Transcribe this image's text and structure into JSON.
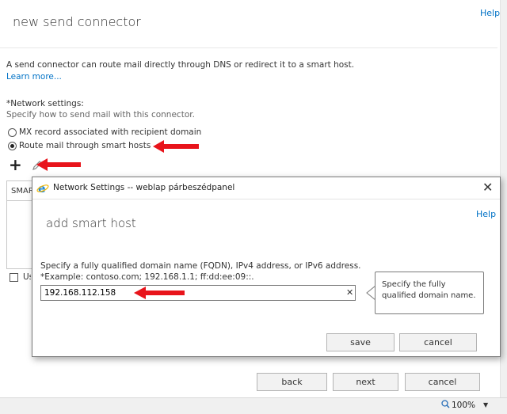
{
  "page": {
    "title": "new send connector",
    "help": "Help",
    "intro_text": "A send connector can route mail directly through DNS or redirect it to a smart host.",
    "learn_more": "Learn more...",
    "network_label": "*Network settings:",
    "network_desc": "Specify how to send mail with this connector.",
    "radio_mx": "MX record associated with recipient domain",
    "radio_smart": "Route mail through smart hosts",
    "list_header": "SMART HOST",
    "use_label": "Use"
  },
  "buttons": {
    "back": "back",
    "next": "next",
    "cancel": "cancel"
  },
  "status": {
    "zoom": "100%"
  },
  "dialog": {
    "window_title": "Network Settings -- weblap párbeszédpanel",
    "help": "Help",
    "heading": "add smart host",
    "description": "Specify a fully qualified domain name (FQDN), IPv4 address, or IPv6 address.",
    "example": "*Example: contoso.com; 192.168.1.1; ff:dd:ee:09::.",
    "input_value": "192.168.112.158",
    "tooltip": "Specify the fully qualified domain name.",
    "save": "save",
    "cancel": "cancel"
  },
  "icons": {
    "add": "plus-icon",
    "edit": "pencil-icon",
    "close": "close-icon",
    "clear": "clear-icon",
    "zoom": "zoom-icon",
    "browser": "ie-icon"
  },
  "colors": {
    "link": "#0072c6",
    "annotation_arrow": "#e8141b"
  }
}
